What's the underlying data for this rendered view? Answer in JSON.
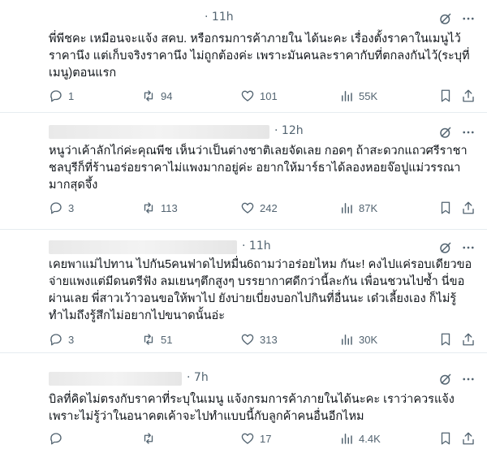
{
  "posts": [
    {
      "time": "11h",
      "text": "พี่พีชคะ เหมือนจะแจ้ง สคบ. หรือกรมการค้าภายใน ได้นะคะ เรื่องตั้งราคาในเมนูไว้ราคานึง แต่เก็บจริงราคานึง ไม่ถูกต้องค่ะ เพราะมันคนละราคากับที่ตกลงกันไว้(ระบุที่เมนู)ตอนแรก",
      "replies": "1",
      "reposts": "94",
      "likes": "101",
      "views": "55K"
    },
    {
      "time": "12h",
      "text": "หนูว่าเค้าลักไก่ค่ะคุณพีช เห็นว่าเป็นต่างชาติเลยจัดเลย กอดๆ ถ้าสะดวกแถวศรีราชาชลบุรีก็ที่ร้านอร่อยราคาไม่แพงมากอยู่ค่ะ อยากให้มาร์ธาได้ลองหอยจ๊อปูแม่วรรณามากสุดจึ้ง",
      "replies": "3",
      "reposts": "113",
      "likes": "242",
      "views": "87K"
    },
    {
      "time": "11h",
      "text": "เคยพาแม่ไปทาน ไปกัน5คนฟาดไปหมื่น6ถามว่าอร่อยไหม กันะ! คงไปแค่รอบเดียวขอจ่ายแพงแต่มีดนตรีฟัง ลมเยนๆตึกสูงๆ บรรยากาศดีกว่านี้ละกัน เพื่อนชวนไปซ้ำ นี่ขอผ่านเลย พี่สาวเว้าวอนขอให้พาไป ยังบ่ายเบี่ยงบอกไปกินที่อื่นนะ เด๋วเลี้ยงเอง ก็ไม่รู้ทำไมถึงรู้สึกไม่อยากไปขนาดนั้นอ่ะ",
      "replies": "3",
      "reposts": "51",
      "likes": "313",
      "views": "30K"
    },
    {
      "time": "7h",
      "text": "บิลที่คิดไม่ตรงกับราคาที่ระบุในเมนู แจ้งกรมการค้าภายในได้นะคะ เราว่าควรแจ้ง เพราะไม่รู้ว่าในอนาคตเค้าจะไปทำแบบนี้กับลูกค้าคนอื่นอีกไหม",
      "replies": "",
      "reposts": "",
      "likes": "17",
      "views": "4.4K"
    }
  ],
  "icons": {
    "reply": "reply-icon",
    "repost": "repost-icon",
    "like": "heart-icon",
    "views": "views-icon",
    "bookmark": "bookmark-icon",
    "share": "share-icon",
    "grok": "grok-icon",
    "more": "more-icon"
  },
  "colors": {
    "text": "#0f1419",
    "muted": "#536471",
    "divider": "#e6ecf0"
  }
}
